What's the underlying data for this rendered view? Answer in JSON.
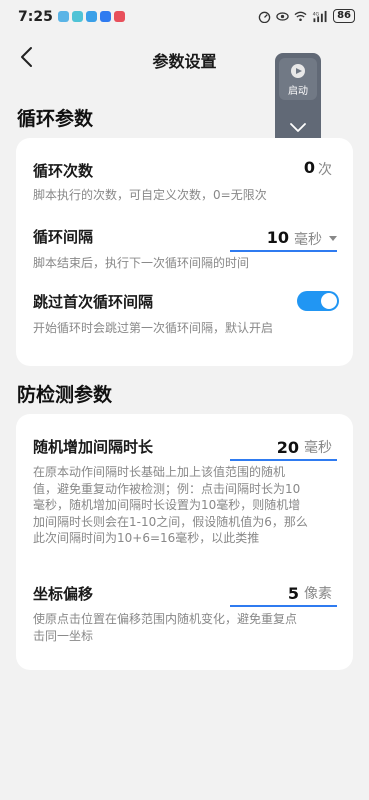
{
  "status_bar": {
    "time": "7:25",
    "battery": "86",
    "app_colors": [
      "#5ab4e6",
      "#4fc3d6",
      "#3aa0e8",
      "#2f7bf0",
      "#e8505b"
    ]
  },
  "header": {
    "title": "参数设置"
  },
  "float_panel": {
    "start_label": "启动"
  },
  "loop_section": {
    "title": "循环参数",
    "loop_count": {
      "label": "循环次数",
      "value": "0",
      "unit": "次",
      "desc": "脚本执行的次数，可自定义次数，0=无限次"
    },
    "loop_interval": {
      "label": "循环间隔",
      "value": "10",
      "unit": "毫秒",
      "desc": "脚本结束后，执行下一次循环间隔的时间"
    },
    "skip_first": {
      "label": "跳过首次循环间隔",
      "enabled": true,
      "desc": "开始循环时会跳过第一次循环间隔，默认开启"
    }
  },
  "anti_detect_section": {
    "title": "防检测参数",
    "random_interval": {
      "label": "随机增加间隔时长",
      "value": "20",
      "unit": "毫秒",
      "desc_lines": [
        "在原本动作间隔时长基础上加上该值范围的随机",
        "值，避免重复动作被检测；例：点击间隔时长为10",
        "毫秒，随机增加间隔时长设置为10毫秒，则随机增",
        "加间隔时长则会在1-10之间，假设随机值为6，那么",
        "此次间隔时间为10+6=16毫秒，以此类推"
      ]
    },
    "coord_offset": {
      "label": "坐标偏移",
      "value": "5",
      "unit": "像素",
      "desc_lines": [
        "使原点击位置在偏移范围内随机变化，避免重复点",
        "击同一坐标"
      ]
    }
  },
  "colors": {
    "accent": "#2f7bf0",
    "toggle_on": "#2196f3",
    "background": "#f2f2f2",
    "card": "#ffffff"
  }
}
